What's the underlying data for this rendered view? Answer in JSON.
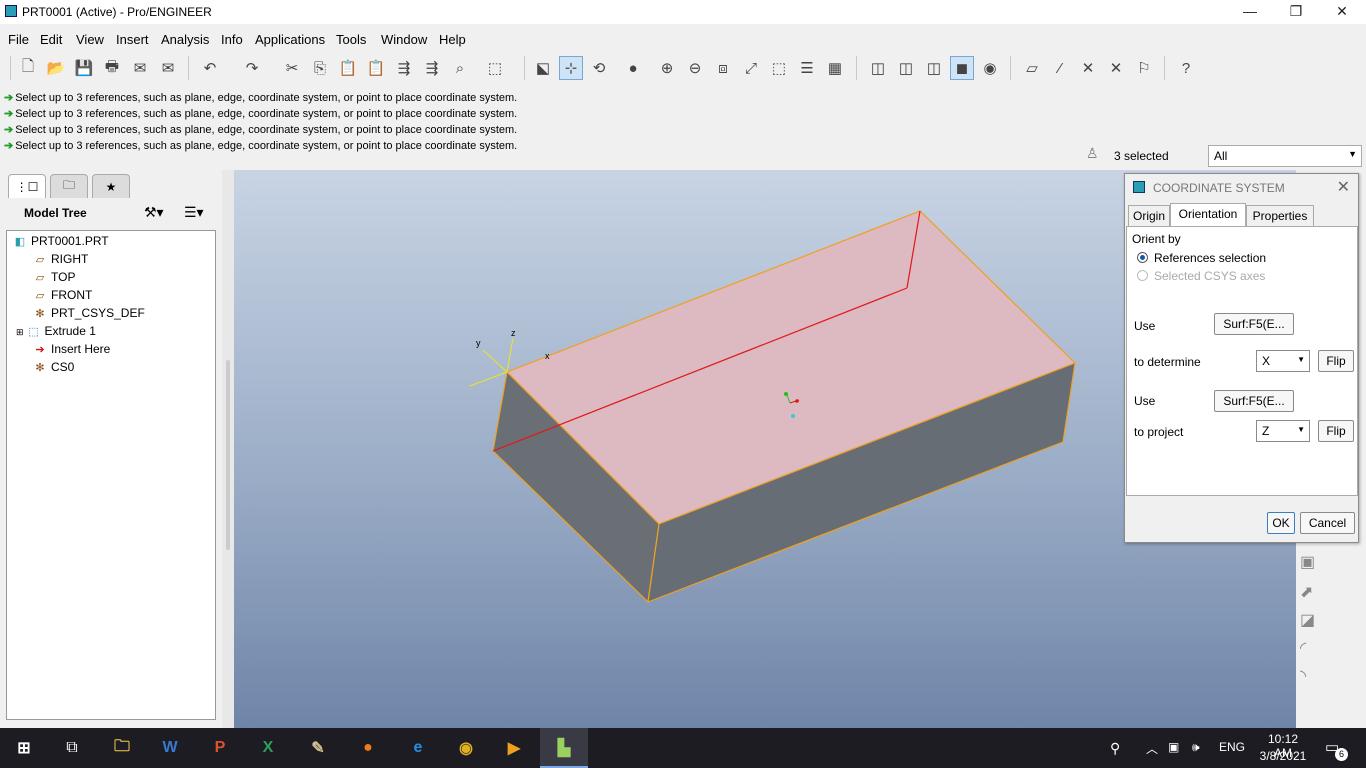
{
  "window": {
    "title": "PRT0001 (Active) - Pro/ENGINEER",
    "minimize": "—",
    "restore": "❐",
    "close": "✕"
  },
  "menu": [
    "File",
    "Edit",
    "View",
    "Insert",
    "Analysis",
    "Info",
    "Applications",
    "Tools",
    "Window",
    "Help"
  ],
  "messages": [
    "Select up to 3 references, such as plane, edge, coordinate system, or point to place coordinate system.",
    "Select up to 3 references, such as plane, edge, coordinate system, or point to place coordinate system.",
    "Select up to 3 references, such as plane, edge, coordinate system, or point to place coordinate system.",
    "Select up to 3 references, such as plane, edge, coordinate system, or point to place coordinate system."
  ],
  "selection": {
    "count_text": "3 selected",
    "filter_value": "All"
  },
  "model_tree": {
    "title": "Model Tree",
    "nodes": [
      {
        "label": "PRT0001.PRT",
        "icon": "part-icon"
      },
      {
        "label": "RIGHT",
        "icon": "datum-plane-icon"
      },
      {
        "label": "TOP",
        "icon": "datum-plane-icon"
      },
      {
        "label": "FRONT",
        "icon": "datum-plane-icon"
      },
      {
        "label": "PRT_CSYS_DEF",
        "icon": "csys-icon"
      },
      {
        "label": "Extrude 1",
        "icon": "extrude-icon"
      },
      {
        "label": "Insert Here",
        "icon": "insert-arrow-icon"
      },
      {
        "label": "CS0",
        "icon": "csys-icon"
      }
    ]
  },
  "viewport": {
    "axis_labels": {
      "y": "y",
      "z": "z",
      "x": "x"
    }
  },
  "dialog": {
    "title": "COORDINATE SYSTEM",
    "tabs": [
      "Origin",
      "Orientation",
      "Properties"
    ],
    "selected_tab": "Orientation",
    "orient_by_label": "Orient by",
    "options": [
      {
        "label": "References selection",
        "selected": true,
        "enabled": true
      },
      {
        "label": "Selected CSYS axes",
        "selected": false,
        "enabled": false
      }
    ],
    "use1_label": "Use",
    "use1_ref": "Surf:F5(E...",
    "determine_label": "to determine",
    "determine_axis": "X",
    "flip1": "Flip",
    "use2_label": "Use",
    "use2_ref": "Surf:F5(E...",
    "project_label": "to project",
    "project_axis": "Z",
    "flip2": "Flip",
    "ok": "OK",
    "cancel": "Cancel"
  },
  "taskbar": {
    "language": "ENG",
    "time": "10:12 AM",
    "date": "3/8/2021",
    "notifications": "6"
  },
  "colors": {
    "accent": "#2a9fb3",
    "top_face": "#ddb9c2",
    "side_face": "#6a6f76",
    "edge_highlight": "#f0a020",
    "reference_edge": "#e01818"
  }
}
